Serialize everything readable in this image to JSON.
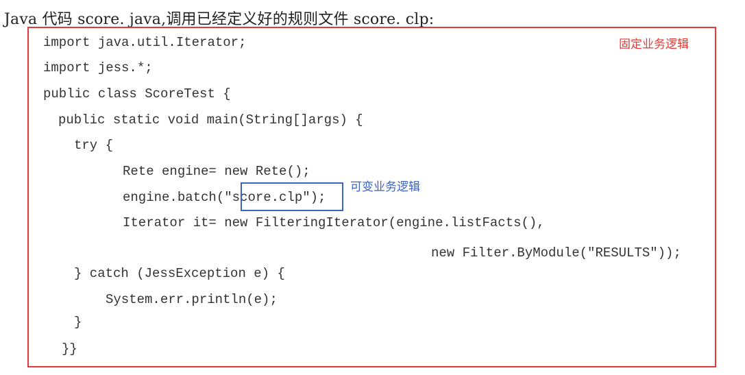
{
  "heading": "Java 代码 score. java,调用已经定义好的规则文件 score. clp:",
  "annotations": {
    "fixed_logic": "固定业务逻辑",
    "variable_logic": "可变业务逻辑"
  },
  "code": {
    "line1": "import java.util.Iterator;",
    "line2": "import jess.*;",
    "line3": "public class ScoreTest {",
    "line4": "public static void main(String[]args) {",
    "line5": "try {",
    "line6": "Rete engine= new Rete();",
    "line7_prefix": "engine.batch(",
    "line7_arg": "\"score.clp\"",
    "line7_suffix": ");",
    "line8": "Iterator it= new FilteringIterator(engine.listFacts(),",
    "line9": "new Filter.ByModule(\"RESULTS\"));",
    "line10": "} catch (JessException e) {",
    "line11": "System.err.println(e);",
    "line12": "}",
    "line13": "}}"
  },
  "colors": {
    "fixed_frame": "#e53935",
    "variable_frame": "#3b63c4"
  }
}
